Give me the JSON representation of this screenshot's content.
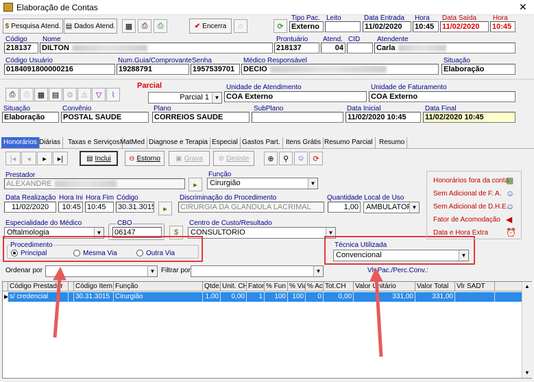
{
  "window": {
    "title": "Elaboração de Contas",
    "close": "✕"
  },
  "toolbar": {
    "pesquisa": "Pesquisa Atend.",
    "dados": "Dados Atend.",
    "encerra": "Encerra"
  },
  "header": {
    "tipo_pac_label": "Tipo Pac.",
    "tipo_pac": "Externo",
    "leito_label": "Leito",
    "leito": "",
    "data_entrada_label": "Data Entrada",
    "data_entrada": "11/02/2020",
    "hora_label": "Hora",
    "hora_entrada": "10:45",
    "data_saida_label": "Data Saída",
    "data_saida": "11/02/2020",
    "hora_saida_label": "Hora",
    "hora_saida": "10:45",
    "codigo_label": "Código",
    "codigo": "218137",
    "nome_label": "Nome",
    "nome": "DILTON",
    "prontuario_label": "Prontuário",
    "prontuario": "218137",
    "atend_label": "Atend.",
    "atend": "04",
    "cid_label": "CID",
    "cid": "",
    "atendente_label": "Atendente",
    "atendente": "Carla",
    "codigo_usuario_label": "Código Usuário",
    "codigo_usuario": "0184091800000216",
    "num_guia_label": "Num.Guia/Comprovante",
    "num_guia": "19288791",
    "senha_label": "Senha",
    "senha": "1957539701",
    "medico_label": "Médico Responsável",
    "medico": "DECIO",
    "situacao_label": "Situação",
    "situacao": "Elaboração"
  },
  "parcial": {
    "title": "Parcial",
    "selected": "Parcial 1",
    "unidade_atend_label": "Unidade de Atendimento",
    "unidade_atend": "COA Externo",
    "unidade_fat_label": "Unidade de Faturamento",
    "unidade_fat": "COA Externo",
    "situacao_label": "Situação",
    "situacao": "Elaboração",
    "convenio_label": "Convênio",
    "convenio": "POSTAL SAUDE",
    "plano_label": "Plano",
    "plano": "CORREIOS SAUDE",
    "subplano_label": "SubPlano",
    "subplano": "",
    "data_inicial_label": "Data Inicial",
    "data_inicial": "11/02/2020 10:45",
    "data_final_label": "Data Final",
    "data_final": "11/02/2020 10:45"
  },
  "tabs": [
    "Honorários",
    "Diárias",
    "Taxas e Serviços",
    "MatMed",
    "Diagnose e Terapia",
    "Especial",
    "Gastos Part.",
    "Itens Grátis",
    "Resumo Parcial",
    "Resumo"
  ],
  "actions": {
    "inclui": "Inclui",
    "estorno": "Estorno",
    "grava": "Grava",
    "desiste": "Desiste"
  },
  "form": {
    "prestador_label": "Prestador",
    "prestador": "ALEXANDRE",
    "funcao_label": "Função",
    "funcao": "Cirurgião",
    "data_realizacao_label": "Data Realização",
    "data_realizacao": "11/02/2020",
    "hora_ini_label": "Hora Ini",
    "hora_ini": "10:45",
    "hora_fim_label": "Hora Fim",
    "hora_fim": "10:45",
    "codigo_label": "Código",
    "codigo": "30.31.3015",
    "discriminacao_label": "Discriminação do Procedimento",
    "discriminacao": "CIRURGIA DA GLANDULA LACRIMAL",
    "quantidade_label": "Quantidade",
    "quantidade": "1,00",
    "local_uso_label": "Local de Uso",
    "local_uso": "AMBULATORI",
    "especialidade_label": "Especialidade do Médico",
    "especialidade": "Oftalmologia",
    "cbo_label": "CBO",
    "cbo": "06147",
    "centro_custo_label": "Centro de Custo/Resultado",
    "centro_custo": "CONSULTORIO",
    "procedimento_label": "Procedimento",
    "proc_options": [
      "Principal",
      "Mesma Via",
      "Outra Via"
    ],
    "tecnica_label": "Técnica Utilizada",
    "tecnica": "Convencional",
    "ordenar_label": "Ordenar por",
    "filtrar_label": "Filtrar por",
    "vlr_pac_label": "Vlr.Pac./Perc.Conv.:"
  },
  "legend": [
    "Honorários fora da conta",
    "Sem Adicional de F. A.",
    "Sem Adicional de D.H.E.",
    "Fator de Acomodação",
    "Data e Hora Extra"
  ],
  "table": {
    "headers": [
      "Código Prestador",
      "Código Item",
      "Função",
      "Qtde.",
      "Unit. CH",
      "Fator",
      "% Fun",
      "% Via",
      "% Acr",
      "Tot.CH",
      "Valor Unitário",
      "Valor Total",
      "Vlr SADT"
    ],
    "rows": [
      [
        "s/ credencial",
        "30.31.3015",
        "Cirurgião",
        "1,00",
        "0,00",
        "1",
        "100",
        "100",
        "0",
        "0,00",
        "331,00",
        "331,00",
        ""
      ]
    ]
  },
  "colors": {
    "accent": "#3b68d8",
    "highlight": "#e03a3a",
    "label": "#00008b"
  }
}
